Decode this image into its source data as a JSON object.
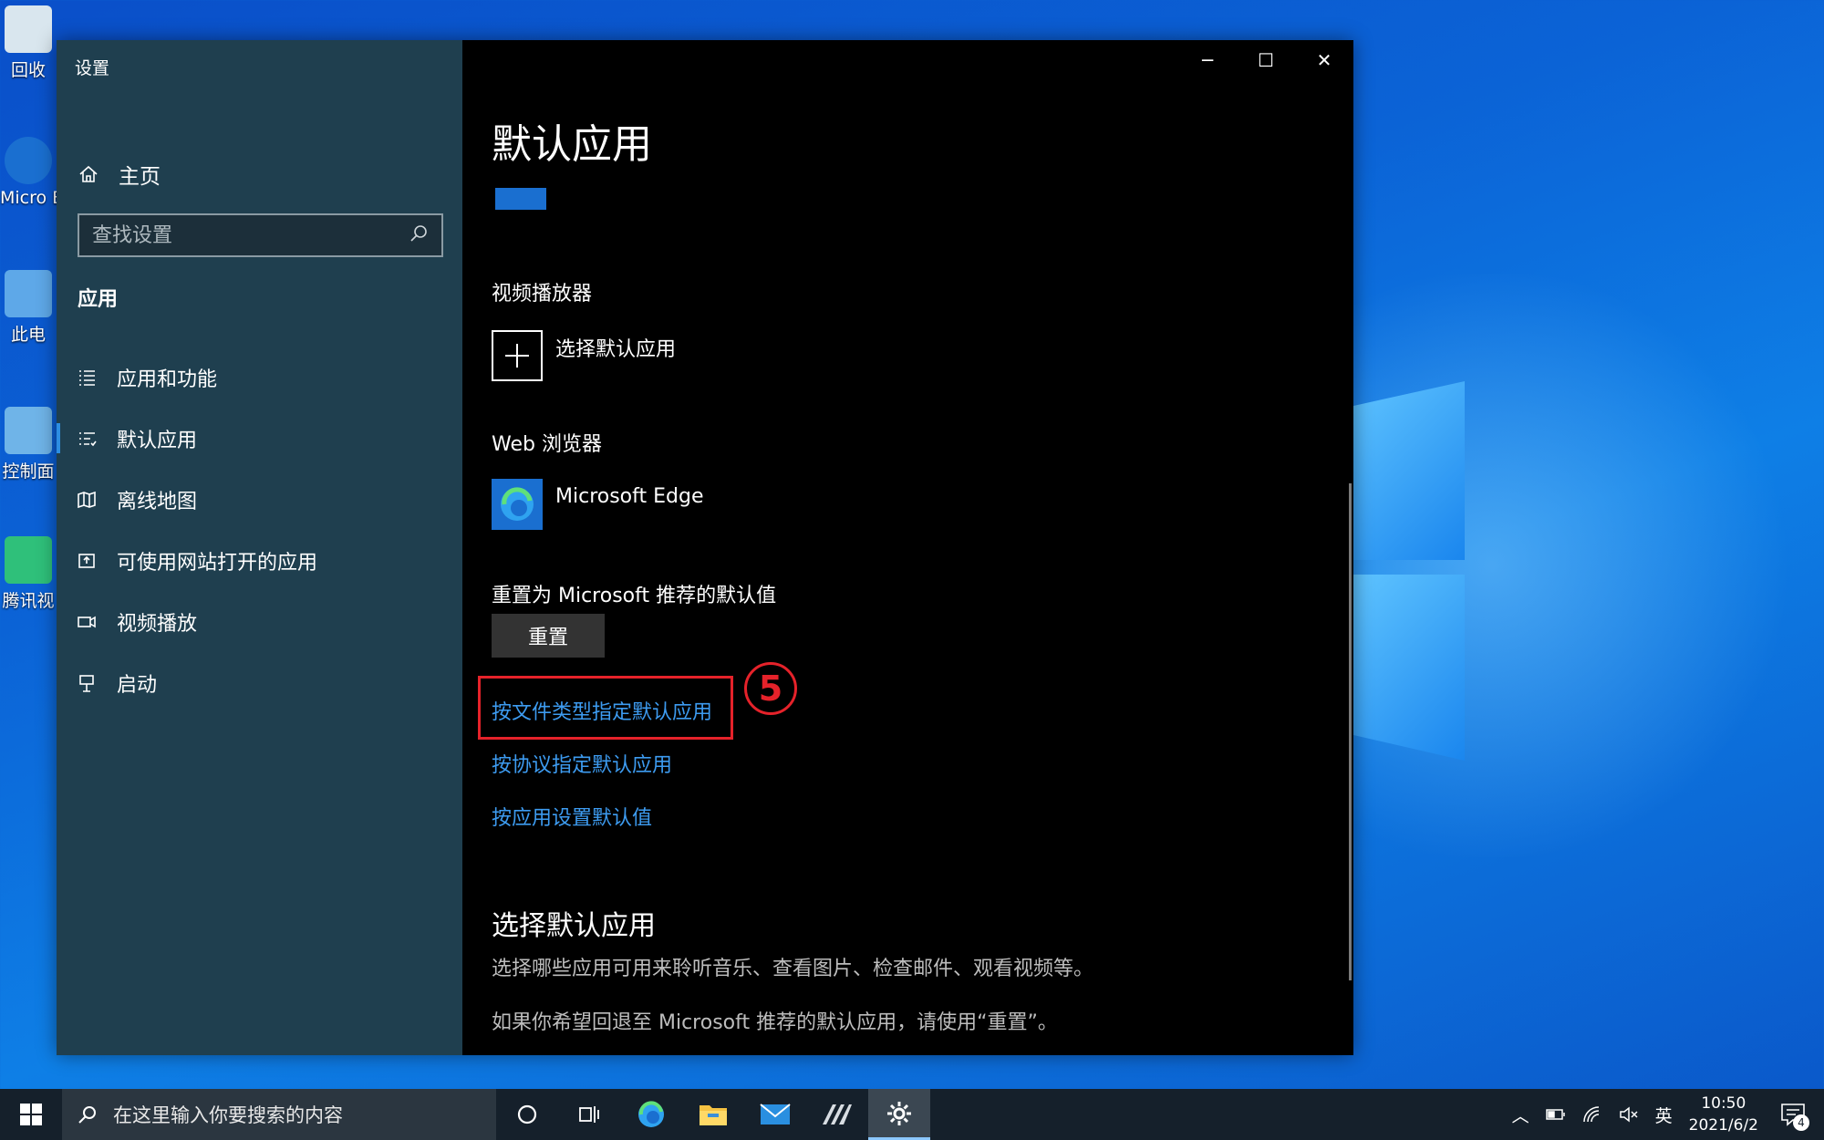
{
  "desktop": {
    "icons": [
      {
        "id": "recycle",
        "label": "回收",
        "color": "#d9e6ee"
      },
      {
        "id": "edge",
        "label": "Micro Edg",
        "color": "#1a6fd0"
      },
      {
        "id": "pc",
        "label": "此电",
        "color": "#5ea8e8"
      },
      {
        "id": "control",
        "label": "控制面",
        "color": "#6fb4e8"
      },
      {
        "id": "tencent",
        "label": "腾讯视",
        "color": "#2fc07a"
      }
    ]
  },
  "window": {
    "title": "设置",
    "controls": {
      "minimize": "─",
      "maximize": "☐",
      "close": "✕"
    }
  },
  "sidebar": {
    "home_label": "主页",
    "search_placeholder": "查找设置",
    "section": "应用",
    "items": [
      {
        "label": "应用和功能",
        "icon": "list-icon",
        "active": false
      },
      {
        "label": "默认应用",
        "icon": "default-apps-icon",
        "active": true
      },
      {
        "label": "离线地图",
        "icon": "map-icon",
        "active": false
      },
      {
        "label": "可使用网站打开的应用",
        "icon": "web-app-icon",
        "active": false
      },
      {
        "label": "视频播放",
        "icon": "video-icon",
        "active": false
      },
      {
        "label": "启动",
        "icon": "startup-icon",
        "active": false
      }
    ]
  },
  "main": {
    "title": "默认应用",
    "video_player": {
      "label": "视频播放器",
      "app": "选择默认应用"
    },
    "web_browser": {
      "label": "Web 浏览器",
      "app": "Microsoft Edge"
    },
    "reset": {
      "label": "重置为 Microsoft 推荐的默认值",
      "button": "重置"
    },
    "links": [
      "按文件类型指定默认应用",
      "按协议指定默认应用",
      "按应用设置默认值"
    ],
    "step_marker": "5",
    "choose_heading": "选择默认应用",
    "choose_desc": "选择哪些应用可用来聆听音乐、查看图片、检查邮件、观看视频等。",
    "reset_hint": "如果你希望回退至 Microsoft 推荐的默认应用，请使用“重置”。"
  },
  "taskbar": {
    "search_placeholder": "在这里输入你要搜索的内容",
    "tray": {
      "language": "英",
      "time": "10:50",
      "date": "2021/6/2",
      "notifications": "4"
    }
  },
  "colors": {
    "sidebar_bg": "#1f3f4f",
    "link": "#3d9bf0",
    "highlight": "#e5222a",
    "accent": "#2d8ee2"
  }
}
